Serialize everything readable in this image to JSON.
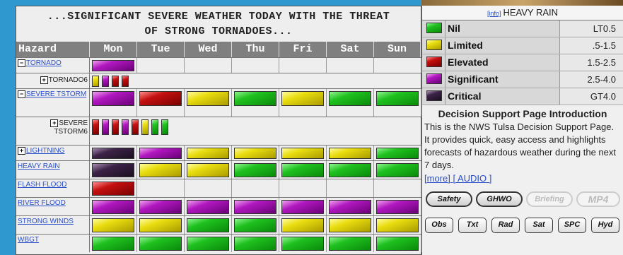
{
  "headline": {
    "line1": "...SIGNIFICANT SEVERE WEATHER TODAY WITH THE THREAT",
    "line2": "OF STRONG TORNADOES..."
  },
  "table": {
    "hazard_header": "Hazard",
    "days": [
      "Mon",
      "Tue",
      "Wed",
      "Thu",
      "Fri",
      "Sat",
      "Sun"
    ],
    "rows": [
      {
        "label": "TORNADO",
        "toggle": "−",
        "levels": [
          "sig",
          null,
          null,
          null,
          null,
          null,
          null
        ]
      },
      {
        "label": "TORNADO6",
        "toggle": "+",
        "sub": true,
        "mini": [
          "lim",
          "sig",
          "elev",
          "elev"
        ]
      },
      {
        "label": "SEVERE TSTORM",
        "toggle": "−",
        "levels": [
          "sig",
          "elev",
          "lim",
          "nil",
          "lim",
          "nil",
          "nil"
        ]
      },
      {
        "label": "SEVERE TSTORM6",
        "toggle": "+",
        "sub": true,
        "mini": [
          "elev",
          "sig",
          "elev",
          "sig",
          "elev",
          "lim",
          "nil",
          "nil"
        ]
      },
      {
        "label": "LIGHTNING",
        "toggle": "+",
        "levels": [
          "crit",
          "sig",
          "lim",
          "lim",
          "lim",
          "lim",
          "nil"
        ]
      },
      {
        "label": "HEAVY RAIN",
        "levels": [
          "crit",
          "lim",
          "lim",
          "nil",
          "nil",
          "nil",
          "nil"
        ]
      },
      {
        "label": "FLASH FLOOD",
        "levels": [
          "elev",
          null,
          null,
          null,
          null,
          null,
          null
        ]
      },
      {
        "label": "RIVER FLOOD",
        "levels": [
          "sig",
          "sig",
          "sig",
          "sig",
          "sig",
          "sig",
          "sig"
        ]
      },
      {
        "label": "STRONG WINDS",
        "levels": [
          "lim",
          "lim",
          "nil",
          "nil",
          "lim",
          "lim",
          "lim"
        ]
      },
      {
        "label": "WBGT",
        "levels": [
          "nil",
          "nil",
          "nil",
          "nil",
          "nil",
          "nil",
          "nil"
        ]
      }
    ]
  },
  "legend": {
    "info_link": "[info]",
    "title": "HEAVY RAIN",
    "items": [
      {
        "level": "nil",
        "name": "Nil",
        "value": "LT0.5"
      },
      {
        "level": "lim",
        "name": "Limited",
        "value": ".5-1.5"
      },
      {
        "level": "elev",
        "name": "Elevated",
        "value": "1.5-2.5"
      },
      {
        "level": "sig",
        "name": "Significant",
        "value": "2.5-4.0"
      },
      {
        "level": "crit",
        "name": "Critical",
        "value": "GT4.0"
      }
    ]
  },
  "intro": {
    "title": "Decision Support Page Introduction",
    "text": "This is the NWS Tulsa Decision Support Page. It provides quick, easy access and highlights forecasts of hazardous weather during the next 7 days.",
    "more_link": "[more]",
    "audio_link": "[ AUDIO ]"
  },
  "buttons": {
    "row1": [
      "Safety",
      "GHWO",
      "Briefing",
      "MP4"
    ],
    "row2": [
      "Obs",
      "Txt",
      "Rad",
      "Sat",
      "SPC",
      "Hyd"
    ]
  },
  "colors": {
    "nil": "#1fc11f",
    "lim": "#e9dd10",
    "elev": "#c41010",
    "sig": "#b118c0",
    "crit": "#3d2348"
  }
}
